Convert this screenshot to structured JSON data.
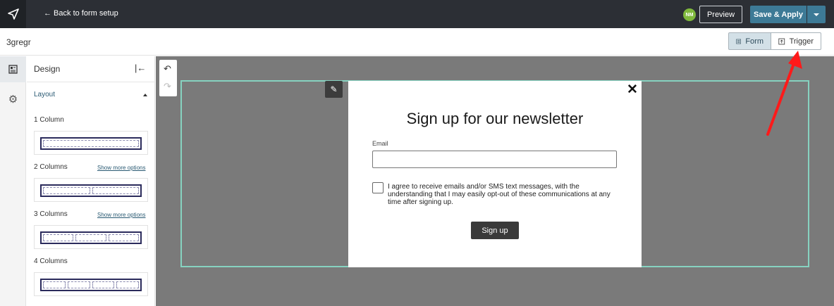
{
  "topbar": {
    "back_label": "← Back to form setup",
    "avatar_initials": "NM",
    "preview_label": "Preview",
    "save_label": "Save & Apply"
  },
  "subbar": {
    "form_name": "3gregr",
    "form_tab": "Form",
    "trigger_tab": "Trigger"
  },
  "panel": {
    "title": "Design",
    "section": "Layout",
    "layouts": [
      {
        "label": "1 Column",
        "more": "",
        "columns": 1
      },
      {
        "label": "2 Columns",
        "more": "Show more options",
        "columns": 2
      },
      {
        "label": "3 Columns",
        "more": "Show more options",
        "columns": 3
      },
      {
        "label": "4 Columns",
        "more": "",
        "columns": 4
      }
    ]
  },
  "popup": {
    "heading": "Sign up for our newsletter",
    "email_label": "Email",
    "email_value": "",
    "consent_text": "I agree to receive emails and/or SMS text messages, with the understanding that I may easily opt-out of these communications at any time after signing up.",
    "button_label": "Sign up",
    "close_glyph": "✕"
  },
  "colors": {
    "topbar": "#2c2f35",
    "accent": "#3d7a96",
    "canvas": "#7a7a7a",
    "selection": "#86d2c0",
    "annotation_arrow": "#ff1a1a"
  }
}
